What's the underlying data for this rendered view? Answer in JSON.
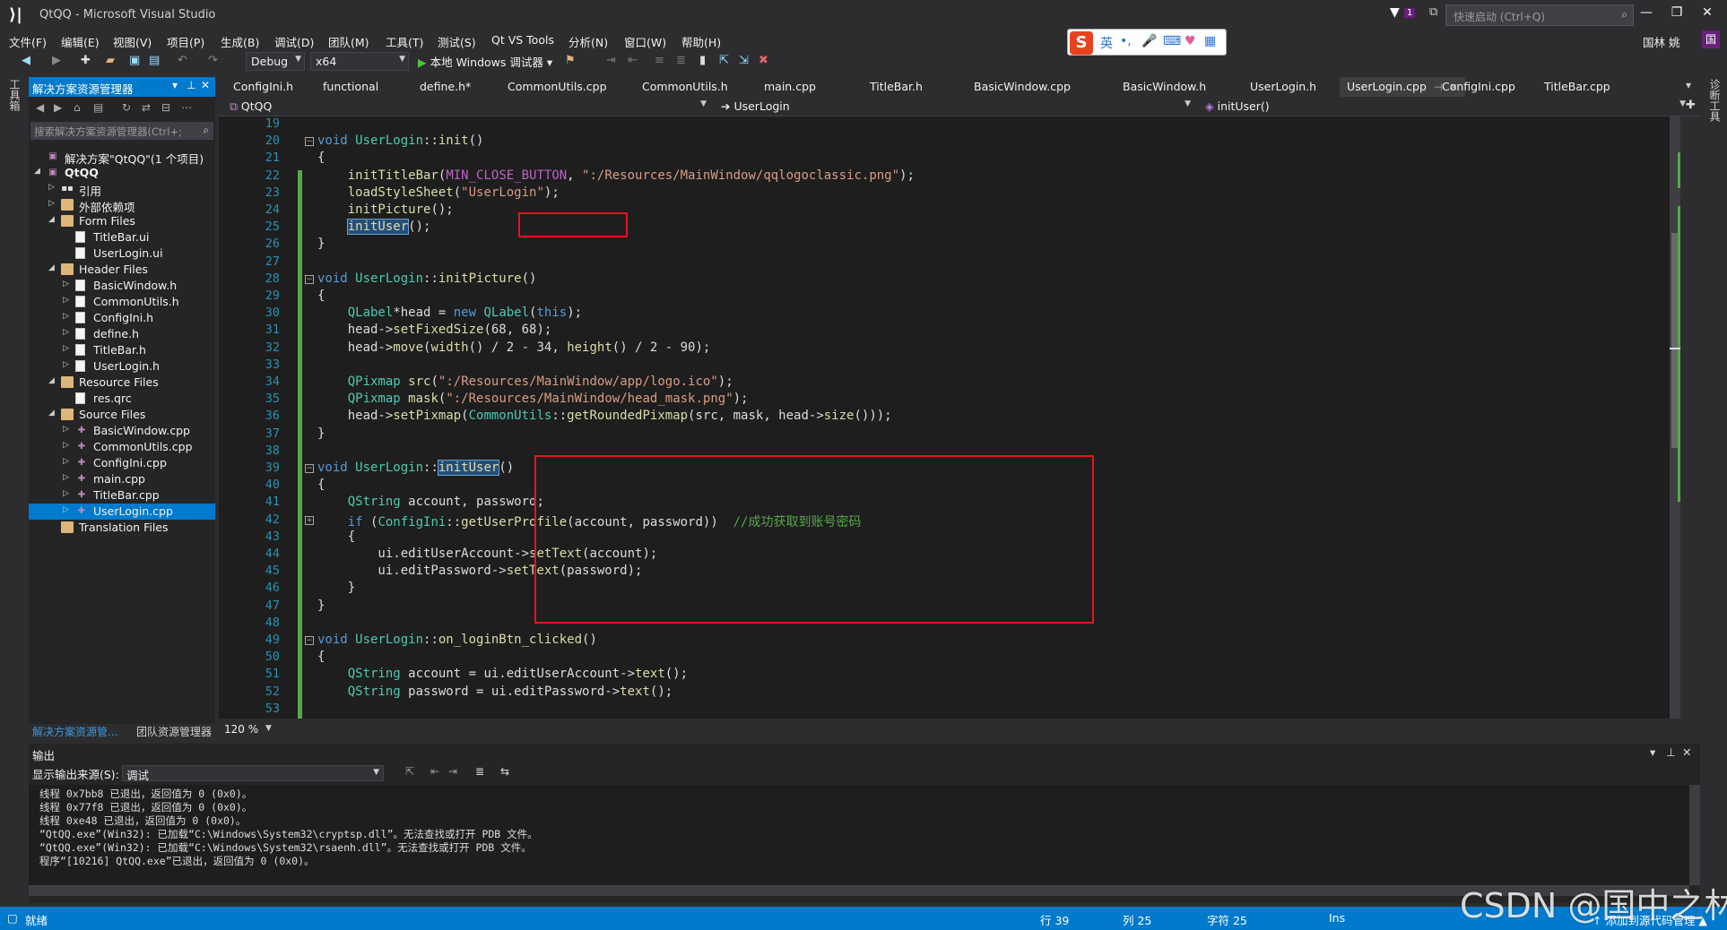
{
  "window": {
    "title": "QtQQ - Microsoft Visual Studio",
    "quick_launch_placeholder": "快速启动 (Ctrl+Q)",
    "filter_badge": "1",
    "user_name": "国林 姚",
    "user_initial": "国"
  },
  "menu": [
    "文件(F)",
    "编辑(E)",
    "视图(V)",
    "项目(P)",
    "生成(B)",
    "调试(D)",
    "团队(M)",
    "工具(T)",
    "测试(S)",
    "Qt VS Tools",
    "分析(N)",
    "窗口(W)",
    "帮助(H)"
  ],
  "ime": {
    "label_en": "英",
    "punct": "•,"
  },
  "toolbar": {
    "config": "Debug",
    "platform": "x64",
    "run_label": "本地 Windows 调试器"
  },
  "left_strip": {
    "label": "工具箱"
  },
  "right_strip": {
    "label": "诊断工具"
  },
  "solution_explorer": {
    "title": "解决方案资源管理器",
    "search_placeholder": "搜索解决方案资源管理器(Ctrl+;",
    "tree": [
      {
        "label": "解决方案\"QtQQ\"(1 个项目)",
        "depth": 0,
        "icon": "sln",
        "expander": ""
      },
      {
        "label": "QtQQ",
        "depth": 0,
        "icon": "proj",
        "expander": "◢",
        "bold": true
      },
      {
        "label": "引用",
        "depth": 1,
        "icon": "ref",
        "expander": "▷"
      },
      {
        "label": "外部依赖项",
        "depth": 1,
        "icon": "folder",
        "expander": "▷"
      },
      {
        "label": "Form Files",
        "depth": 1,
        "icon": "folder",
        "expander": "◢"
      },
      {
        "label": "TitleBar.ui",
        "depth": 2,
        "icon": "file",
        "expander": ""
      },
      {
        "label": "UserLogin.ui",
        "depth": 2,
        "icon": "file",
        "expander": ""
      },
      {
        "label": "Header Files",
        "depth": 1,
        "icon": "folder",
        "expander": "◢"
      },
      {
        "label": "BasicWindow.h",
        "depth": 2,
        "icon": "file",
        "expander": "▷"
      },
      {
        "label": "CommonUtils.h",
        "depth": 2,
        "icon": "file",
        "expander": "▷"
      },
      {
        "label": "ConfigIni.h",
        "depth": 2,
        "icon": "file",
        "expander": "▷"
      },
      {
        "label": "define.h",
        "depth": 2,
        "icon": "file",
        "expander": "▷"
      },
      {
        "label": "TitleBar.h",
        "depth": 2,
        "icon": "file",
        "expander": "▷"
      },
      {
        "label": "UserLogin.h",
        "depth": 2,
        "icon": "file",
        "expander": "▷"
      },
      {
        "label": "Resource Files",
        "depth": 1,
        "icon": "folder",
        "expander": "◢"
      },
      {
        "label": "res.qrc",
        "depth": 2,
        "icon": "file",
        "expander": ""
      },
      {
        "label": "Source Files",
        "depth": 1,
        "icon": "folder",
        "expander": "◢"
      },
      {
        "label": "BasicWindow.cpp",
        "depth": 2,
        "icon": "cpp",
        "expander": "▷"
      },
      {
        "label": "CommonUtils.cpp",
        "depth": 2,
        "icon": "cpp",
        "expander": "▷"
      },
      {
        "label": "ConfigIni.cpp",
        "depth": 2,
        "icon": "cpp",
        "expander": "▷"
      },
      {
        "label": "main.cpp",
        "depth": 2,
        "icon": "cpp",
        "expander": "▷"
      },
      {
        "label": "TitleBar.cpp",
        "depth": 2,
        "icon": "cpp",
        "expander": "▷"
      },
      {
        "label": "UserLogin.cpp",
        "depth": 2,
        "icon": "cpp",
        "expander": "▷",
        "selected": true
      },
      {
        "label": "Translation Files",
        "depth": 1,
        "icon": "folder",
        "expander": ""
      }
    ],
    "bottom_tabs": [
      "解决方案资源管...",
      "团队资源管理器"
    ]
  },
  "editor_tabs": [
    {
      "label": "ConfigIni.h"
    },
    {
      "label": "functional"
    },
    {
      "label": "define.h*"
    },
    {
      "label": "CommonUtils.cpp"
    },
    {
      "label": "CommonUtils.h"
    },
    {
      "label": "main.cpp"
    },
    {
      "label": "TitleBar.h"
    },
    {
      "label": "BasicWindow.cpp"
    },
    {
      "label": "BasicWindow.h"
    },
    {
      "label": "UserLogin.h"
    },
    {
      "label": "UserLogin.cpp",
      "active": true
    },
    {
      "label": "ConfigIni.cpp"
    },
    {
      "label": "TitleBar.cpp"
    }
  ],
  "navbar": {
    "project": "QtQQ",
    "scope": "UserLogin",
    "member": "initUser()"
  },
  "zoom": "120 %",
  "code_lines": [
    {
      "n": 19,
      "html": ""
    },
    {
      "n": 20,
      "html": "<span class=\"kw\">void</span> <span class=\"ty\">UserLogin</span>::<span class=\"fn\">init</span>()"
    },
    {
      "n": 21,
      "html": "{"
    },
    {
      "n": 22,
      "html": "    <span class=\"fn\">initTitleBar</span>(<span class=\"mac\">MIN_CLOSE_BUTTON</span>, <span class=\"str\">\":/Resources/MainWindow/qqlogoclassic.png\"</span>);"
    },
    {
      "n": 23,
      "html": "    <span class=\"fn\">loadStyleSheet</span>(<span class=\"str\">\"UserLogin\"</span>);"
    },
    {
      "n": 24,
      "html": "    <span class=\"fn\">initPicture</span>();"
    },
    {
      "n": 25,
      "html": "    <span class=\"fn hl\">initUser</span>();"
    },
    {
      "n": 26,
      "html": "}"
    },
    {
      "n": 27,
      "html": ""
    },
    {
      "n": 28,
      "html": "<span class=\"kw\">void</span> <span class=\"ty\">UserLogin</span>::<span class=\"fn\">initPicture</span>()"
    },
    {
      "n": 29,
      "html": "{"
    },
    {
      "n": 30,
      "html": "    <span class=\"ty\">QLabel</span>*head = <span class=\"kw\">new</span> <span class=\"ty\">QLabel</span>(<span class=\"kw\">this</span>);"
    },
    {
      "n": 31,
      "html": "    head-&gt;<span class=\"fn\">setFixedSize</span>(68, 68);"
    },
    {
      "n": 32,
      "html": "    head-&gt;<span class=\"fn\">move</span>(<span class=\"fn\">width</span>() / 2 - 34, <span class=\"fn\">height</span>() / 2 - 90);"
    },
    {
      "n": 33,
      "html": ""
    },
    {
      "n": 34,
      "html": "    <span class=\"ty\">QPixmap</span> <span class=\"fn\">src</span>(<span class=\"str\">\":/Resources/MainWindow/app/logo.ico\"</span>);"
    },
    {
      "n": 35,
      "html": "    <span class=\"ty\">QPixmap</span> <span class=\"fn\">mask</span>(<span class=\"str\">\":/Resources/MainWindow/head_mask.png\"</span>);"
    },
    {
      "n": 36,
      "html": "    head-&gt;<span class=\"fn\">setPixmap</span>(<span class=\"ty\">CommonUtils</span>::<span class=\"fn\">getRoundedPixmap</span>(src, mask, head-&gt;<span class=\"fn\">size</span>()));"
    },
    {
      "n": 37,
      "html": "}"
    },
    {
      "n": 38,
      "html": ""
    },
    {
      "n": 39,
      "html": "<span class=\"kw\">void</span> <span class=\"ty\">UserLogin</span>::<span class=\"fn hl\">initUser</span>()"
    },
    {
      "n": 40,
      "html": "{"
    },
    {
      "n": 41,
      "html": "    <span class=\"ty\">QString</span> account, password;"
    },
    {
      "n": 42,
      "html": "    <span class=\"kw\">if</span> (<span class=\"ty\">ConfigIni</span>::<span class=\"fn\">getUserProfile</span>(account, password))  <span class=\"cm\">//成功获取到账号密码</span>"
    },
    {
      "n": 43,
      "html": "    {"
    },
    {
      "n": 44,
      "html": "        ui.editUserAccount-&gt;<span class=\"fn\">setText</span>(account);"
    },
    {
      "n": 45,
      "html": "        ui.editPassword-&gt;<span class=\"fn\">setText</span>(password);"
    },
    {
      "n": 46,
      "html": "    }"
    },
    {
      "n": 47,
      "html": "}"
    },
    {
      "n": 48,
      "html": ""
    },
    {
      "n": 49,
      "html": "<span class=\"kw\">void</span> <span class=\"ty\">UserLogin</span>::<span class=\"fn\">on_loginBtn_clicked</span>()"
    },
    {
      "n": 50,
      "html": "{"
    },
    {
      "n": 51,
      "html": "    <span class=\"ty\">QString</span> account = ui.editUserAccount-&gt;<span class=\"fn\">text</span>();"
    },
    {
      "n": 52,
      "html": "    <span class=\"ty\">QString</span> password = ui.editPassword-&gt;<span class=\"fn\">text</span>();"
    },
    {
      "n": 53,
      "html": ""
    }
  ],
  "output": {
    "title": "输出",
    "source_label": "显示输出来源(S):",
    "source_value": "调试",
    "lines": [
      "线程 0x7bb8 已退出，返回值为 0 (0x0)。",
      "线程 0x77f8 已退出，返回值为 0 (0x0)。",
      "线程 0xe48 已退出，返回值为 0 (0x0)。",
      "“QtQQ.exe”(Win32): 已加载“C:\\Windows\\System32\\cryptsp.dll”。无法查找或打开 PDB 文件。",
      "“QtQQ.exe”(Win32): 已加载“C:\\Windows\\System32\\rsaenh.dll”。无法查找或打开 PDB 文件。",
      "程序“[10216] QtQQ.exe”已退出，返回值为 0 (0x0)。"
    ]
  },
  "status": {
    "ready": "就绪",
    "line": "行 39",
    "col": "列 25",
    "char": "字符 25",
    "ins": "Ins",
    "source_control": "↑ 添加到源代码管理 ▲"
  },
  "watermark": "CSDN @国中之林",
  "colors": {
    "accent": "#007acc",
    "highlight_box": "#e81123",
    "keyword": "#569cd6",
    "type": "#4ec9b0",
    "string": "#d69d85"
  }
}
